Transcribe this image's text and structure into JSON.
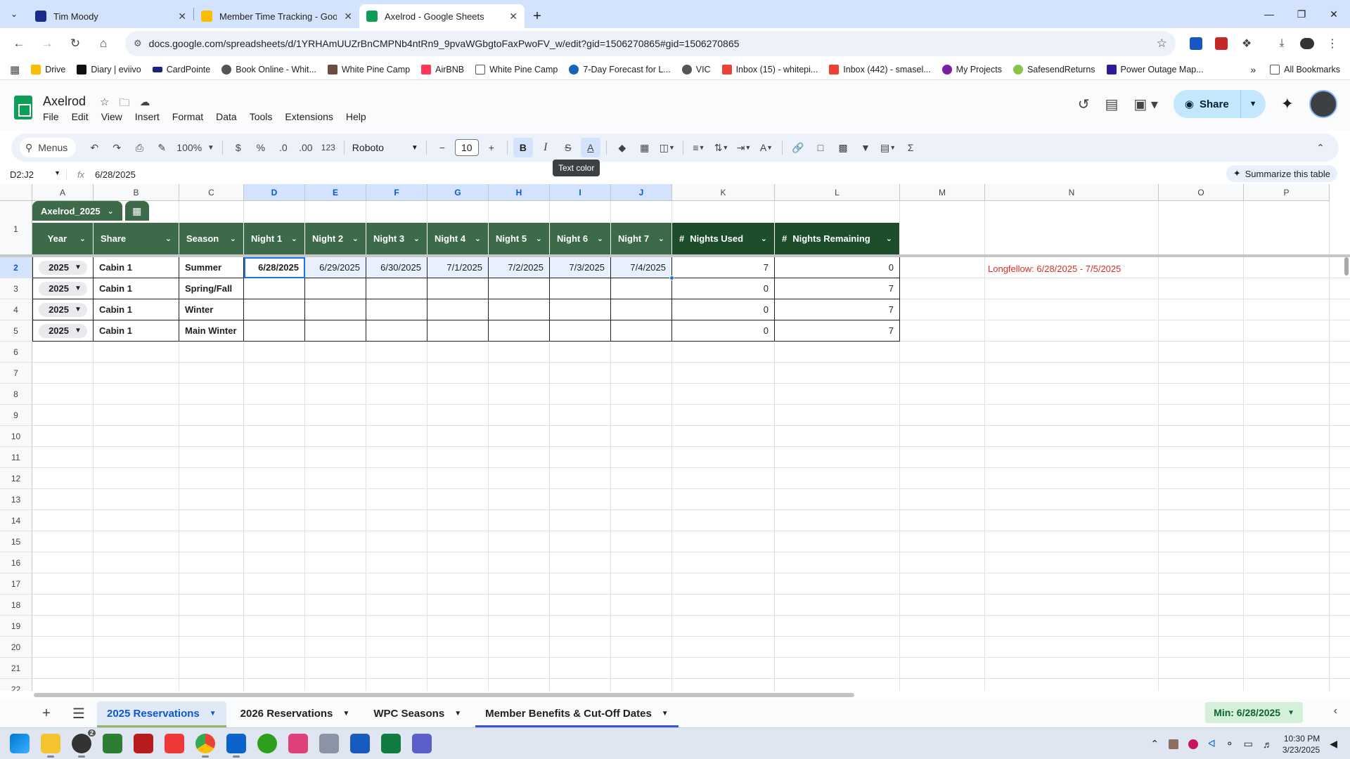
{
  "browser": {
    "tabs": [
      {
        "title": "Tim Moody",
        "favicon_color": "#1a2b8c",
        "active": false
      },
      {
        "title": "Member Time Tracking - Google Drive",
        "favicon_color": "#fbbc04",
        "active": false
      },
      {
        "title": "Axelrod - Google Sheets",
        "favicon_color": "#0f9d58",
        "active": true
      }
    ],
    "url": "docs.google.com/spreadsheets/d/1YRHAmUUZrBnCMPNb4ntRn9_9pvaWGbgtoFaxPwoFV_w/edit?gid=1506270865#gid=1506270865",
    "bookmarks": [
      {
        "label": "Drive",
        "color": "#fbbc04"
      },
      {
        "label": "Diary | eviivo",
        "color": "#111111"
      },
      {
        "label": "CardPointe",
        "color": "#1a237e"
      },
      {
        "label": "Book Online - Whit...",
        "color": "#555555"
      },
      {
        "label": "White Pine Camp",
        "color": "#6d4c41"
      },
      {
        "label": "AirBNB",
        "color": "#ff385c"
      },
      {
        "label": "White Pine Camp",
        "color": "#777777"
      },
      {
        "label": "7-Day Forecast for L...",
        "color": "#1565c0"
      },
      {
        "label": "VIC",
        "color": "#555555"
      },
      {
        "label": "Inbox (15) - whitepi...",
        "color": "#ea4335"
      },
      {
        "label": "Inbox (442) - smasel...",
        "color": "#ea4335"
      },
      {
        "label": "My Projects",
        "color": "#7b1fa2"
      },
      {
        "label": "SafesendReturns",
        "color": "#8bc34a"
      },
      {
        "label": "Power Outage Map...",
        "color": "#311b92"
      }
    ],
    "all_bookmarks": "All Bookmarks"
  },
  "sheets": {
    "doc_title": "Axelrod",
    "menu": [
      "File",
      "Edit",
      "View",
      "Insert",
      "Format",
      "Data",
      "Tools",
      "Extensions",
      "Help"
    ],
    "share_label": "Share",
    "toolbar": {
      "menus_label": "Menus",
      "zoom": "100%",
      "currency": "$",
      "percent": "%",
      "dec_decrease": ".0",
      "dec_increase": ".00",
      "number_format": "123",
      "font": "Roboto",
      "font_size": "10",
      "tooltip": "Text color"
    },
    "formula": {
      "name_box": "D2:J2",
      "fx": "fx",
      "value": "6/28/2025",
      "summarize_label": "Summarize this table"
    },
    "columns": [
      "A",
      "B",
      "C",
      "D",
      "E",
      "F",
      "G",
      "H",
      "I",
      "J",
      "K",
      "L",
      "M",
      "N",
      "O",
      "P"
    ],
    "rows": [
      "1",
      "2",
      "3",
      "4",
      "5",
      "6",
      "7",
      "8",
      "9",
      "10",
      "11",
      "12",
      "13",
      "14",
      "15",
      "16",
      "17",
      "18",
      "19",
      "20",
      "21",
      "22"
    ],
    "table_name": "Axelrod_2025",
    "headers": [
      "Year",
      "Share",
      "Season",
      "Night 1",
      "Night 2",
      "Night 3",
      "Night 4",
      "Night 5",
      "Night 6",
      "Night 7",
      "Nights Used",
      "Nights Remaining"
    ],
    "header_hash": "#",
    "data_rows": [
      {
        "year": "2025",
        "share": "Cabin 1",
        "season": "Summer",
        "nights": [
          "6/28/2025",
          "6/29/2025",
          "6/30/2025",
          "7/1/2025",
          "7/2/2025",
          "7/3/2025",
          "7/4/2025"
        ],
        "used": "7",
        "remaining": "0"
      },
      {
        "year": "2025",
        "share": "Cabin 1",
        "season": "Spring/Fall",
        "nights": [
          "",
          "",
          "",
          "",
          "",
          "",
          ""
        ],
        "used": "0",
        "remaining": "7"
      },
      {
        "year": "2025",
        "share": "Cabin 1",
        "season": "Winter",
        "nights": [
          "",
          "",
          "",
          "",
          "",
          "",
          ""
        ],
        "used": "0",
        "remaining": "7"
      },
      {
        "year": "2025",
        "share": "Cabin 1",
        "season": "Main Winter",
        "nights": [
          "",
          "",
          "",
          "",
          "",
          "",
          ""
        ],
        "used": "0",
        "remaining": "7"
      }
    ],
    "note": "Longfellow: 6/28/2025 - 7/5/2025",
    "sheet_tabs": [
      "2025 Reservations",
      "2026 Reservations",
      "WPC Seasons",
      "Member Benefits & Cut-Off Dates"
    ],
    "stat_chip": "Min: 6/28/2025",
    "colors": {
      "header_green": "#3d6b4a",
      "numeric_header": "#1e4d2b",
      "note_red": "#d93025",
      "selection": "#1a73e8"
    }
  },
  "taskbar": {
    "badge": "2",
    "time": "10:30 PM",
    "date": "3/23/2025"
  }
}
